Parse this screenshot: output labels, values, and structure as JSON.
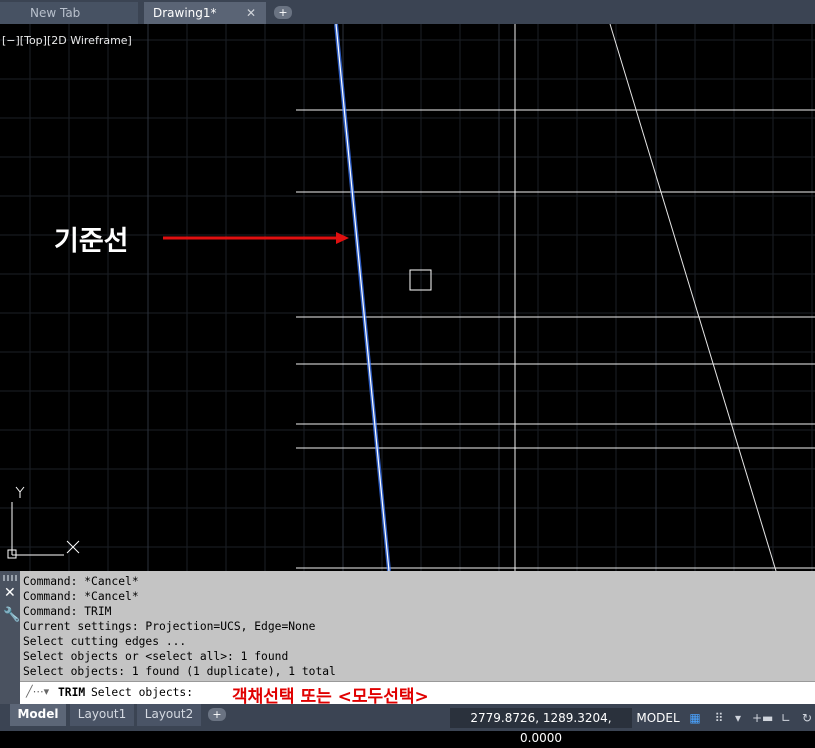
{
  "tabs": {
    "new_tab": "New Tab",
    "drawing": "Drawing1*",
    "close_glyph": "✕",
    "add_glyph": "+"
  },
  "viewport": {
    "view_label": "[−][Top][2D Wireframe]",
    "annotation_label": "기준선",
    "annotation_color": "#e01010",
    "background": "#000000",
    "ucs": {
      "x_label": "X",
      "y_label": "Y"
    }
  },
  "command_panel": {
    "history": [
      "Command: *Cancel*",
      "Command: *Cancel*",
      "Command: TRIM",
      "Current settings: Projection=UCS, Edge=None",
      "Select cutting edges ...",
      "Select objects or <select all>: 1 found",
      "Select objects: 1 found (1 duplicate), 1 total"
    ],
    "input_command": "TRIM",
    "input_prompt": "Select objects:",
    "note": "객채선택 또는 <모두선택>",
    "note_color": "#e00000"
  },
  "statusbar": {
    "layout_tabs": [
      "Model",
      "Layout1",
      "Layout2"
    ],
    "add_glyph": "+",
    "coordinates": "2779.8726, 1289.3204, 0.0000",
    "model_label": "MODEL",
    "icons": [
      "grid-icon",
      "snap-icon",
      "dropdown-icon",
      "ortho-icon",
      "polar-icon",
      "osnap-icon"
    ]
  }
}
